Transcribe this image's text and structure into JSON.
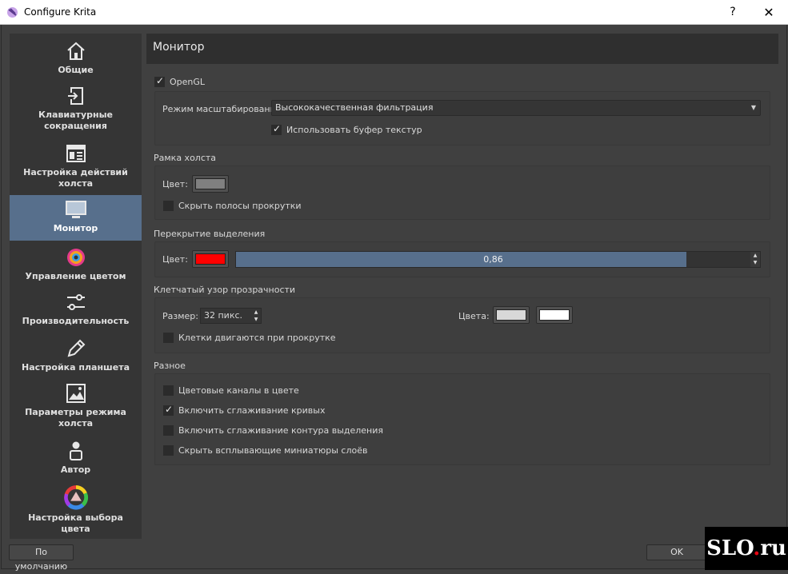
{
  "window": {
    "title": "Configure Krita",
    "help": "?",
    "close": "✕"
  },
  "sidebar": {
    "items": [
      {
        "label": "Общие",
        "icon": "home-icon"
      },
      {
        "label": "Клавиатурные сокращения",
        "icon": "shortcut-icon"
      },
      {
        "label": "Настройка действий холста",
        "icon": "canvas-input-icon"
      },
      {
        "label": "Монитор",
        "icon": "monitor-icon",
        "active": true
      },
      {
        "label": "Управление цветом",
        "icon": "color-management-icon"
      },
      {
        "label": "Производительность",
        "icon": "sliders-icon"
      },
      {
        "label": "Настройка планшета",
        "icon": "pen-icon"
      },
      {
        "label": "Параметры режима холста",
        "icon": "image-icon"
      },
      {
        "label": "Автор",
        "icon": "user-icon"
      },
      {
        "label": "Настройка выбора цвета",
        "icon": "color-wheel-icon"
      }
    ]
  },
  "page": {
    "title": "Монитор"
  },
  "opengl": {
    "label": "OpenGL",
    "checked": true,
    "scaling_label": "Режим масштабирования:",
    "scaling_value": "Высококачественная фильтрация",
    "texture_buffer_label": "Использовать буфер текстур",
    "texture_buffer_checked": true
  },
  "canvas_border": {
    "title": "Рамка холста",
    "color_label": "Цвет:",
    "color": "#808080",
    "hide_scrollbars_label": "Скрыть полосы прокрутки",
    "hide_scrollbars_checked": false
  },
  "selection_overlay": {
    "title": "Перекрытие выделения",
    "color_label": "Цвет:",
    "color": "#ff0000",
    "opacity": "0,86",
    "opacity_fraction": 0.86
  },
  "checkers": {
    "title": "Клетчатый узор прозрачности",
    "size_label": "Размер:",
    "size_value": "32 пикс.",
    "colors_label": "Цвета:",
    "color1": "#d8d8d8",
    "color2": "#ffffff",
    "move_label": "Клетки двигаются при прокрутке",
    "move_checked": false
  },
  "misc": {
    "title": "Разное",
    "options": [
      {
        "label": "Цветовые каналы в цвете",
        "checked": false
      },
      {
        "label": "Включить сглаживание кривых",
        "checked": true
      },
      {
        "label": "Включить сглаживание контура выделения",
        "checked": false
      },
      {
        "label": "Скрыть всплывающие миниатюры слоёв",
        "checked": false
      }
    ]
  },
  "buttons": {
    "defaults": "По умолчанию",
    "ok": "OK"
  },
  "watermark": {
    "text_a": "SLO",
    "dot": ".",
    "text_b": "ru"
  },
  "colors": {
    "accent": "#576f8c",
    "background": "#404040",
    "sidebar": "#353535"
  }
}
